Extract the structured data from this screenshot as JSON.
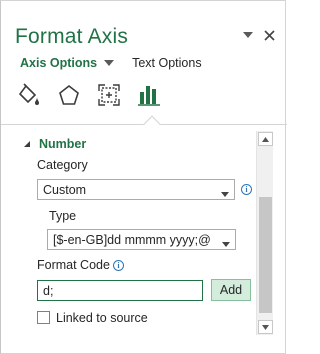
{
  "pane": {
    "title": "Format Axis",
    "title_buttons": [
      "chevron-down-icon",
      "close-icon"
    ]
  },
  "tabs": {
    "axis_options": "Axis Options",
    "text_options": "Text Options"
  },
  "icon_tabs": [
    "fill-line-icon",
    "effects-icon",
    "size-properties-icon",
    "axis-options-icon"
  ],
  "section": {
    "title": "Number",
    "category_label": "Category",
    "category_value": "Custom",
    "type_label": "Type",
    "type_value": "[$-en-GB]dd mmmm yyyy;@",
    "format_code_label": "Format Code",
    "format_code_value": "d;",
    "add_label": "Add",
    "linked_label": "Linked to source"
  },
  "colors": {
    "accent": "#217346",
    "info": "#2e75b6",
    "add_button_bg": "#d3ecdc"
  }
}
